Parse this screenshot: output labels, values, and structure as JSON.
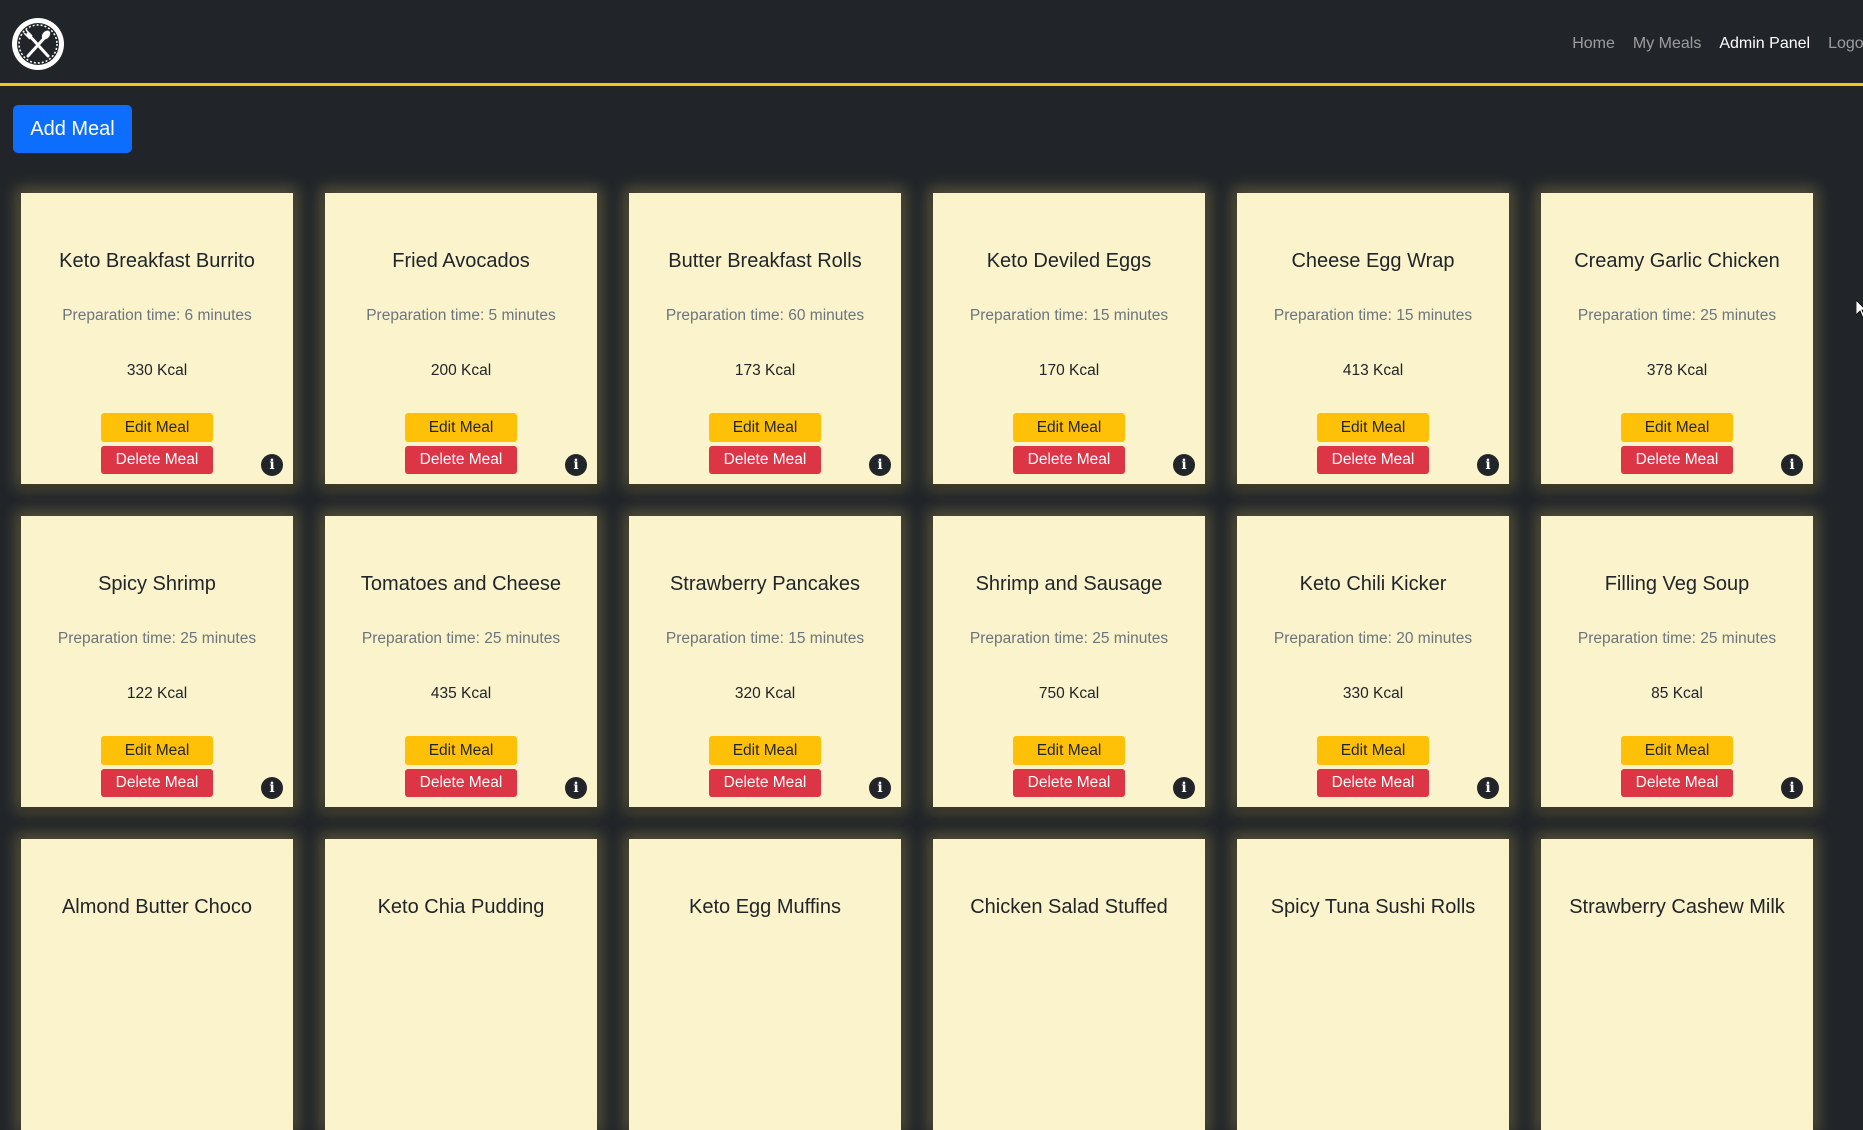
{
  "nav": {
    "logo": "fork-knife-icon",
    "links": [
      "Home",
      "My Meals",
      "Admin Panel",
      "Logout"
    ],
    "active": "Admin Panel"
  },
  "add_meal_label": "Add Meal",
  "card_labels": {
    "edit": "Edit Meal",
    "delete": "Delete Meal",
    "info_icon": "info-icon"
  },
  "meals": [
    {
      "name": "Keto Breakfast Burrito",
      "prep": "Preparation time: 6 minutes",
      "kcal": "330 Kcal"
    },
    {
      "name": "Fried Avocados",
      "prep": "Preparation time: 5 minutes",
      "kcal": "200 Kcal"
    },
    {
      "name": "Butter Breakfast Rolls",
      "prep": "Preparation time: 60 minutes",
      "kcal": "173 Kcal"
    },
    {
      "name": "Keto Deviled Eggs",
      "prep": "Preparation time: 15 minutes",
      "kcal": "170 Kcal"
    },
    {
      "name": "Cheese Egg Wrap",
      "prep": "Preparation time: 15 minutes",
      "kcal": "413 Kcal"
    },
    {
      "name": "Creamy Garlic Chicken",
      "prep": "Preparation time: 25 minutes",
      "kcal": "378 Kcal"
    },
    {
      "name": "Spicy Shrimp",
      "prep": "Preparation time: 25 minutes",
      "kcal": "122 Kcal"
    },
    {
      "name": "Tomatoes and Cheese",
      "prep": "Preparation time: 25 minutes",
      "kcal": "435 Kcal"
    },
    {
      "name": "Strawberry Pancakes",
      "prep": "Preparation time: 15 minutes",
      "kcal": "320 Kcal"
    },
    {
      "name": "Shrimp and Sausage",
      "prep": "Preparation time: 25 minutes",
      "kcal": "750 Kcal"
    },
    {
      "name": "Keto Chili Kicker",
      "prep": "Preparation time: 20 minutes",
      "kcal": "330 Kcal"
    },
    {
      "name": "Filling Veg Soup",
      "prep": "Preparation time: 25 minutes",
      "kcal": "85 Kcal"
    },
    {
      "name": "Almond Butter Choco",
      "prep": "",
      "kcal": ""
    },
    {
      "name": "Keto Chia Pudding",
      "prep": "",
      "kcal": ""
    },
    {
      "name": "Keto Egg Muffins",
      "prep": "",
      "kcal": ""
    },
    {
      "name": "Chicken Salad Stuffed",
      "prep": "",
      "kcal": ""
    },
    {
      "name": "Spicy Tuna Sushi Rolls",
      "prep": "",
      "kcal": ""
    },
    {
      "name": "Strawberry Cashew Milk",
      "prep": "",
      "kcal": ""
    }
  ],
  "colors": {
    "background": "#212529",
    "accent_line": "#f5c518",
    "card": "#faf3cc",
    "primary": "#0d6efd",
    "warning": "#ffc107",
    "danger": "#dc3545"
  }
}
